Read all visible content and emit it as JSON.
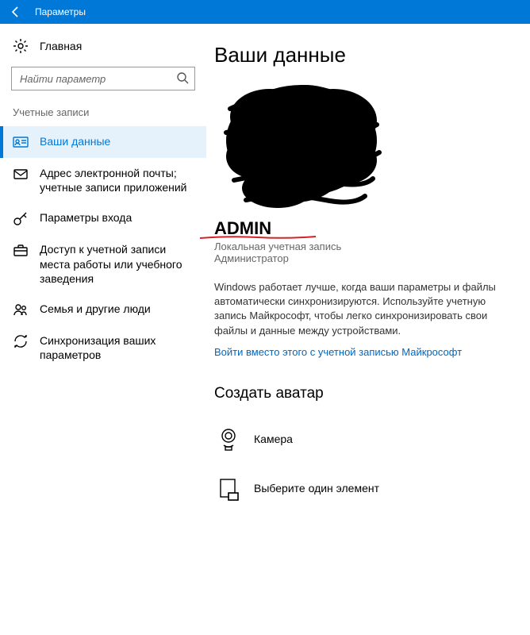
{
  "titlebar": {
    "title": "Параметры"
  },
  "sidebar": {
    "home": "Главная",
    "search_placeholder": "Найти параметр",
    "section": "Учетные записи",
    "items": [
      {
        "label": "Ваши данные"
      },
      {
        "label": "Адрес электронной почты; учетные записи приложений"
      },
      {
        "label": "Параметры входа"
      },
      {
        "label": "Доступ к учетной записи места работы или учебного заведения"
      },
      {
        "label": "Семья и другие люди"
      },
      {
        "label": "Синхронизация ваших параметров"
      }
    ]
  },
  "main": {
    "title": "Ваши данные",
    "username": "ADMIN",
    "account_type": "Локальная учетная запись",
    "account_role": "Администратор",
    "description": "Windows работает лучше, когда ваши параметры и файлы автоматически синхронизируются. Используйте учетную запись Майкрософт, чтобы легко синхронизировать свои файлы и данные между устройствами.",
    "ms_link": "Войти вместо этого с учетной записью Майкрософт",
    "create_avatar_title": "Создать аватар",
    "camera_label": "Камера",
    "browse_label": "Выберите один элемент"
  }
}
